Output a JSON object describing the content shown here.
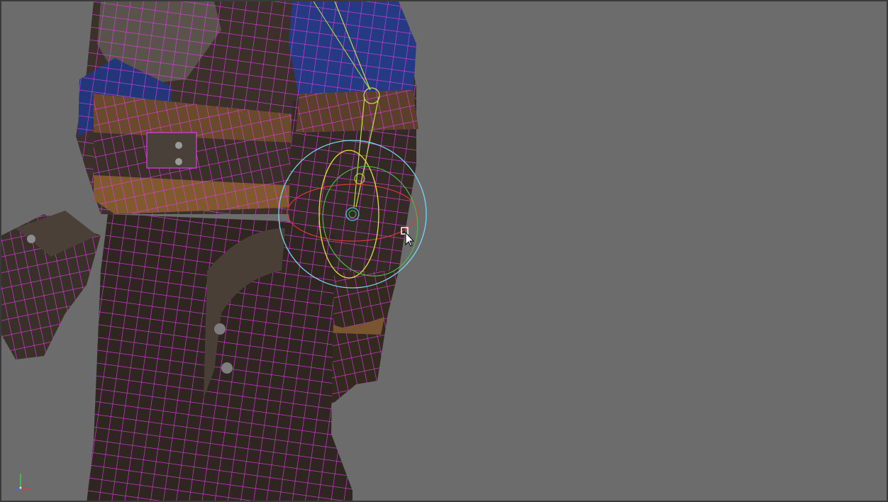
{
  "viewport": {
    "background_color": "#6c6c6c",
    "wireframe_color": "#e23de8",
    "selection_ring_color": "#78d6f2",
    "rotate_x_color": "#d83a3a",
    "rotate_y_color": "#e6df3c",
    "rotate_z_color": "#4fb34f",
    "bone_color": "#c4e04a"
  },
  "gizmo": {
    "type": "rotate-manipulator",
    "axes": [
      "X",
      "Y",
      "Z"
    ]
  },
  "axis_indicator": {
    "axes": [
      "X",
      "Y",
      "Z"
    ],
    "colors": {
      "x": "#d83a3a",
      "y": "#4fb34f",
      "z": "#4a6ad8"
    }
  },
  "cursor": {
    "icon": "move-arrow-cursor-icon"
  }
}
